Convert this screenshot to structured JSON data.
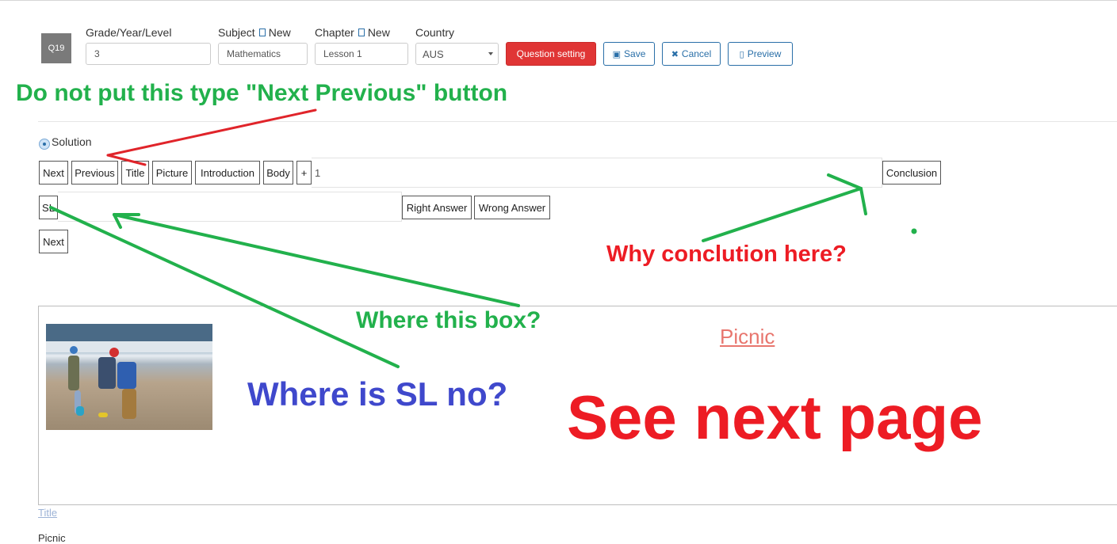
{
  "header": {
    "question_badge": "Q19",
    "grade": {
      "label": "Grade/Year/Level",
      "value": "3"
    },
    "subject": {
      "label": "Subject",
      "new_label": "New",
      "value": "Mathematics"
    },
    "chapter": {
      "label": "Chapter",
      "new_label": "New",
      "value": "Lesson 1"
    },
    "country": {
      "label": "Country",
      "value": "AUS"
    },
    "buttons": {
      "question_setting": "Question setting",
      "save": "Save",
      "cancel": "Cancel",
      "preview": "Preview"
    }
  },
  "solution": {
    "label": "Solution",
    "toolbar": [
      "Next",
      "Previous",
      "Title",
      "Picture",
      "Introduction",
      "Body",
      "+"
    ],
    "body_value": "1",
    "conclusion": "Conclusion",
    "sl_label": "SL",
    "right_answer": "Right Answer",
    "wrong_answer": "Wrong Answer",
    "next2": "Next"
  },
  "preview": {
    "picnic_title": "Picnic",
    "title_link": "Title",
    "picnic_text": "Picnic"
  },
  "annotations": {
    "next_previous": "Do not put this type \"Next Previous\" button",
    "conclusion_q": "Why conclution here?",
    "box_q": "Where this box?",
    "sl_q": "Where is SL no?",
    "see_next": "See next page"
  },
  "colors": {
    "annotation_green": "#22b14c",
    "annotation_red": "#ed1c24",
    "annotation_blue": "#3f48cc",
    "accent_red": "#e03535",
    "accent_blue": "#2a6fa8"
  }
}
